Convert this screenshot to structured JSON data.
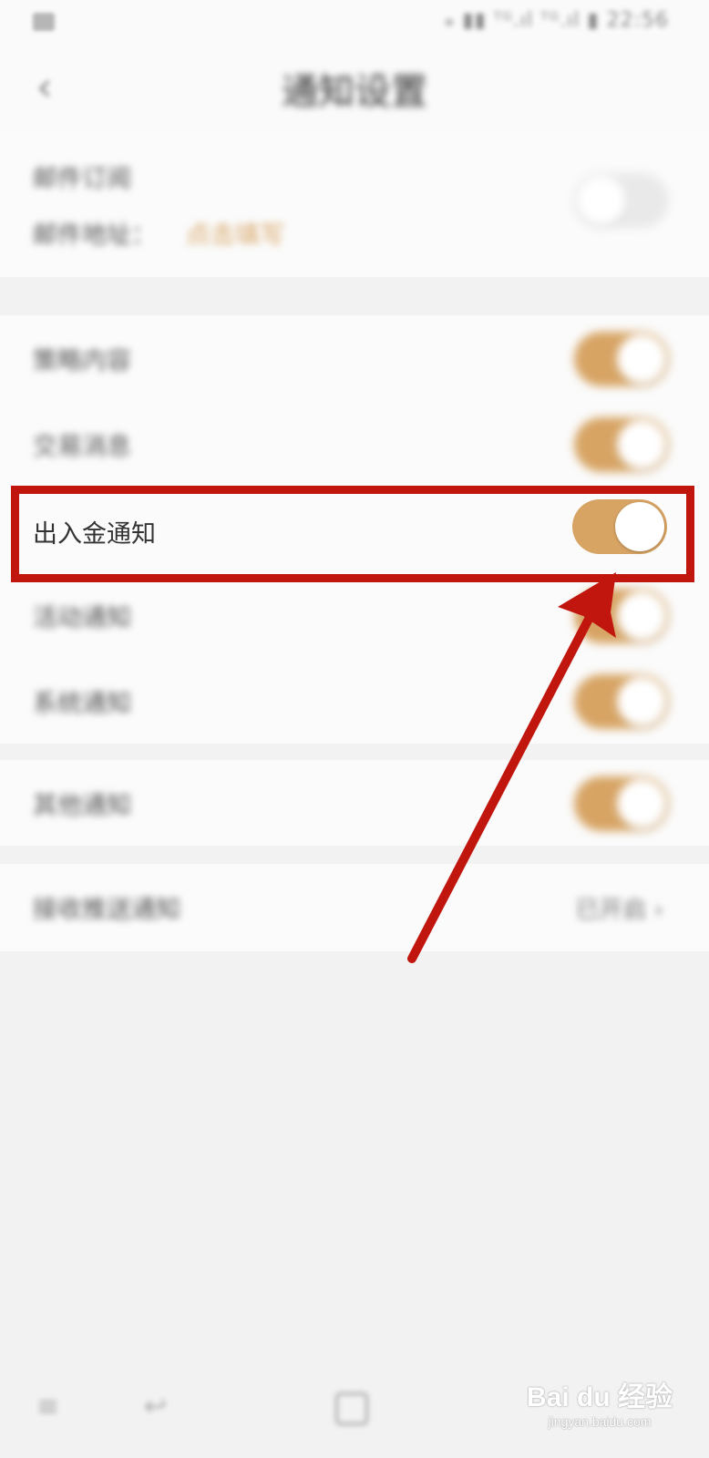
{
  "status_bar": {
    "right_text": "⁎ ▮▮ ᵀᴳ.ıl ᵀᴳ.ıl ▮ 22:56"
  },
  "header": {
    "back_label": "‹",
    "title": "通知设置"
  },
  "email": {
    "subscribe_label": "邮件订阅",
    "address_label": "邮件地址：",
    "address_link": "点击填写",
    "toggle_on": false
  },
  "notifications": [
    {
      "label": "策略内容",
      "on": true,
      "blurred": true
    },
    {
      "label": "交易消息",
      "on": true,
      "blurred": true
    },
    {
      "label": "出入金通知",
      "on": true,
      "blurred": false
    },
    {
      "label": "活动通知",
      "on": true,
      "blurred": true
    },
    {
      "label": "系统通知",
      "on": true,
      "blurred": true
    }
  ],
  "other": {
    "label": "其他通知",
    "on": true
  },
  "push": {
    "label": "接收推送通知",
    "status": "已开启 ›"
  },
  "bottom_nav": {
    "icons": [
      "menu-icon",
      "back-icon",
      "home-icon"
    ]
  },
  "watermark": {
    "main": "Bai du 经验",
    "sub": "jingyan.baidu.com"
  },
  "colors": {
    "accent": "#d7a464",
    "highlight_red": "#c0160e",
    "background": "#f2f2f2",
    "card": "#fbfbfb"
  }
}
